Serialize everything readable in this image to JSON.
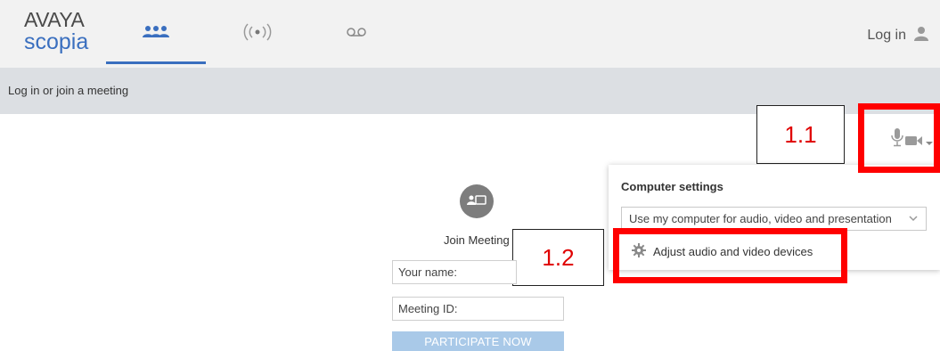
{
  "header": {
    "logo": {
      "line1": "AVAYA",
      "line2": "scopia"
    },
    "tabs": [
      {
        "icon": "people-icon",
        "active": true
      },
      {
        "icon": "broadcast-icon",
        "active": false
      },
      {
        "icon": "voicemail-icon",
        "active": false
      }
    ],
    "login_label": "Log in",
    "accent": "#3a6fbf"
  },
  "subheader": {
    "title": "Log in or join a meeting"
  },
  "annotations": {
    "callout_1": "1.1",
    "callout_2": "1.2",
    "color": "#ff0000"
  },
  "settings_panel": {
    "title": "Computer settings",
    "mode_selected": "Use my computer for audio, video and presentation",
    "adjust_label": "Adjust audio and video devices"
  },
  "join": {
    "label": "Join Meeting",
    "name_placeholder": "Your name:",
    "meeting_id_placeholder": "Meeting ID:",
    "participate_label": "PARTICIPATE NOW"
  }
}
